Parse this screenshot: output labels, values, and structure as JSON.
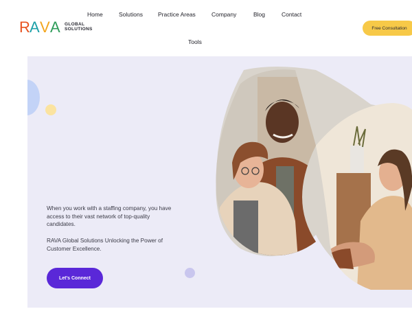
{
  "brand": {
    "logo_text": "RAVA",
    "logo_line1": "GLOBAL",
    "logo_line2": "SOLUTIONS",
    "colors": {
      "r": "#e8521f",
      "a1": "#1ca0a8",
      "v": "#f3a51d",
      "a2": "#2e9c5a"
    }
  },
  "nav": {
    "items": [
      "Home",
      "Solutions",
      "Practice Areas",
      "Company",
      "Blog",
      "Contact",
      "Tools"
    ]
  },
  "header_cta": {
    "label": "Free Consultation",
    "color": "#f7c948"
  },
  "hero": {
    "paragraph1": "When you work with a staffing company, you have access to their vast network of top-quality candidates.",
    "paragraph2": "RAVA Global Solutions Unlocking the Power of Customer Excellence.",
    "cta_label": "Let's Connect",
    "cta_color": "#5a28d8",
    "background": "#ecebf7"
  }
}
